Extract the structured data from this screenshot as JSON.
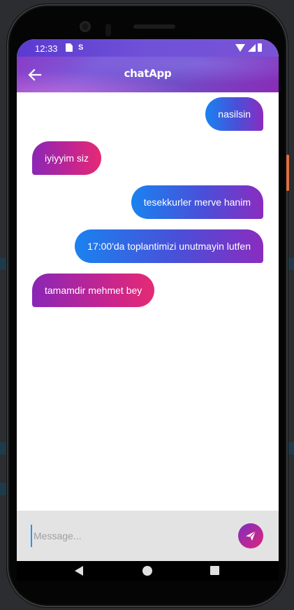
{
  "status_bar": {
    "time": "12:33",
    "s_label": "S"
  },
  "app_bar": {
    "title": "chatApp",
    "back_icon": "arrow-left-icon"
  },
  "messages": [
    {
      "text": "nasilsin",
      "sender": "me"
    },
    {
      "text": "iyiyyim siz",
      "sender": "them"
    },
    {
      "text": "tesekkurler merve hanim",
      "sender": "me"
    },
    {
      "text": "17:00'da toplantimizi unutmayin lutfen",
      "sender": "me"
    },
    {
      "text": "tamamdir mehmet bey",
      "sender": "them"
    }
  ],
  "composer": {
    "placeholder": "Message...",
    "value": "",
    "send_icon": "send-icon"
  },
  "colors": {
    "sent_gradient": [
      "#1a82f0",
      "#8a2cc0"
    ],
    "received_gradient": [
      "#8a26b6",
      "#e52a74"
    ],
    "app_bar": "#7b5bd9",
    "composer_bg": "#e3e3e3"
  }
}
